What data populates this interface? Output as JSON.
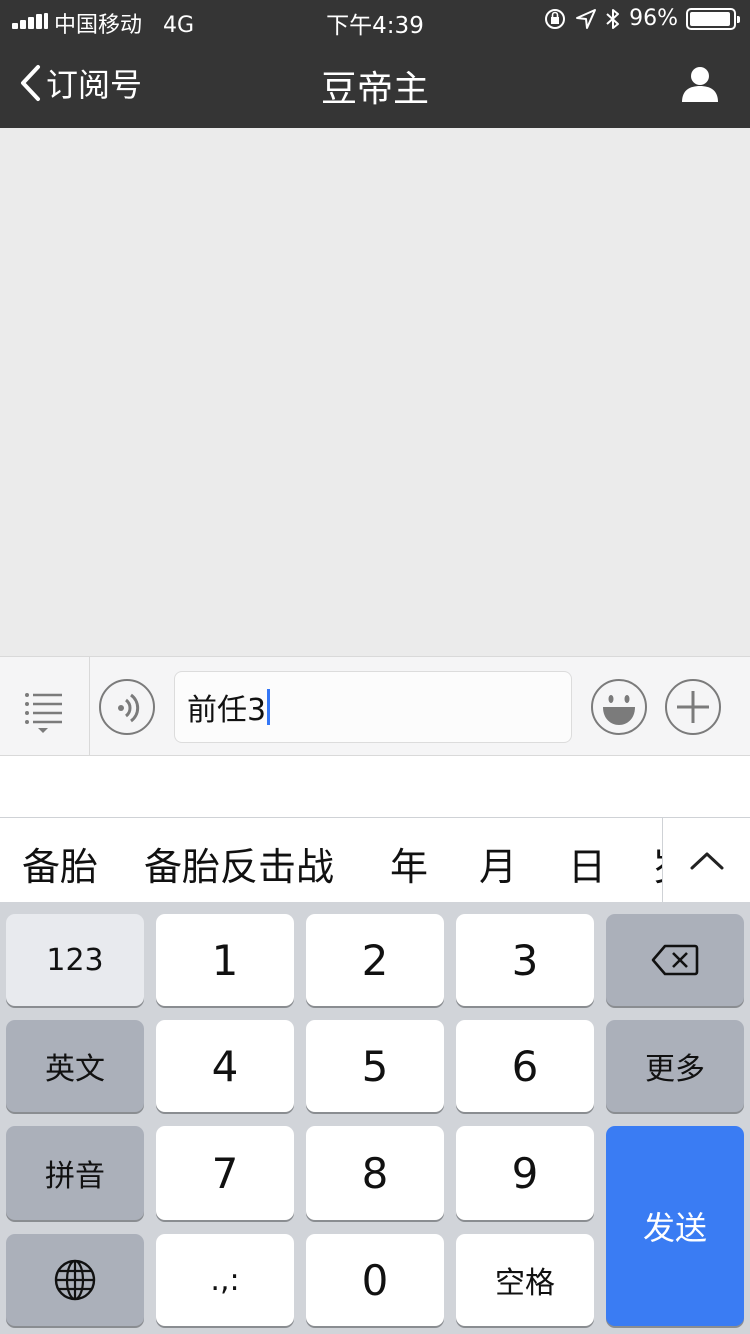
{
  "status_bar": {
    "carrier": "中国移动",
    "network": "4G",
    "time": "下午4:39",
    "battery_percent": "96%",
    "battery_level": 0.96
  },
  "nav": {
    "back_label": "订阅号",
    "title": "豆帝主",
    "icons": {
      "back": "chevron-left-icon",
      "profile": "person-icon"
    }
  },
  "input_bar": {
    "text": "前任3",
    "icons": [
      "menu-list-icon",
      "voice-icon",
      "emoji-icon",
      "plus-icon"
    ]
  },
  "candidates": [
    "备胎",
    "备胎反击战",
    "年",
    "月",
    "日",
    "岁"
  ],
  "keyboard": {
    "row1": [
      "123",
      "1",
      "2",
      "3"
    ],
    "row2": [
      "英文",
      "4",
      "5",
      "6",
      "更多"
    ],
    "row3": [
      "拼音",
      "7",
      "8",
      "9"
    ],
    "row4": [
      ".,:",
      "0",
      "空格"
    ],
    "send": "发送"
  },
  "colors": {
    "nav_bg": "#353535",
    "send_key": "#3a7cf3",
    "cursor": "#3477f6"
  }
}
